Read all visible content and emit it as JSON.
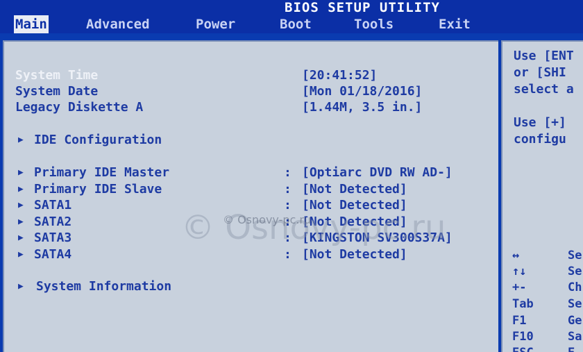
{
  "title": "BIOS SETUP UTILITY",
  "menu": [
    "Main",
    "Advanced",
    "Power",
    "Boot",
    "Tools",
    "Exit"
  ],
  "active_menu": "Main",
  "settings": [
    {
      "label": "System Time",
      "value": "[20:41:52]"
    },
    {
      "label": "System Date",
      "value": "[Mon 01/18/2016]"
    },
    {
      "label": "Legacy Diskette A",
      "value": "[1.44M, 3.5 in.]"
    }
  ],
  "submenus": [
    {
      "label": "IDE Configuration"
    },
    {
      "label": "Primary IDE Master",
      "colon": ":",
      "value": "[Optiarc DVD RW AD-]"
    },
    {
      "label": "Primary IDE Slave",
      "colon": ":",
      "value": "[Not Detected]"
    },
    {
      "label": "SATA1",
      "colon": ":",
      "value": "[Not Detected]"
    },
    {
      "label": "SATA2",
      "colon": ":",
      "value": "[Not Detected]"
    },
    {
      "label": "SATA3",
      "colon": ":",
      "value": "[KINGSTON SV300S37A]"
    },
    {
      "label": "SATA4",
      "colon": ":",
      "value": "[Not Detected]"
    },
    {
      "label": "System Information"
    }
  ],
  "help": {
    "lines": [
      "Use [ENT",
      "or [SHI",
      "select a",
      "Use [+]",
      "configu"
    ],
    "keys": [
      {
        "key": "↔",
        "desc": "Se"
      },
      {
        "key": "↑↓",
        "desc": "Se"
      },
      {
        "key": "+-",
        "desc": "Ch"
      },
      {
        "key": "Tab",
        "desc": "Se"
      },
      {
        "key": "F1",
        "desc": "Ge"
      },
      {
        "key": "F10",
        "desc": "Sa"
      },
      {
        "key": "ESC",
        "desc": "E"
      }
    ]
  },
  "watermark": {
    "large": "© Osnovy-pc.ru",
    "small": "© Osnovy-pc.ru"
  },
  "colors": {
    "background": "#0a3bb0",
    "panel": "#c8d1dd",
    "text": "#1e3ba3",
    "highlight": "#eef1f7"
  }
}
